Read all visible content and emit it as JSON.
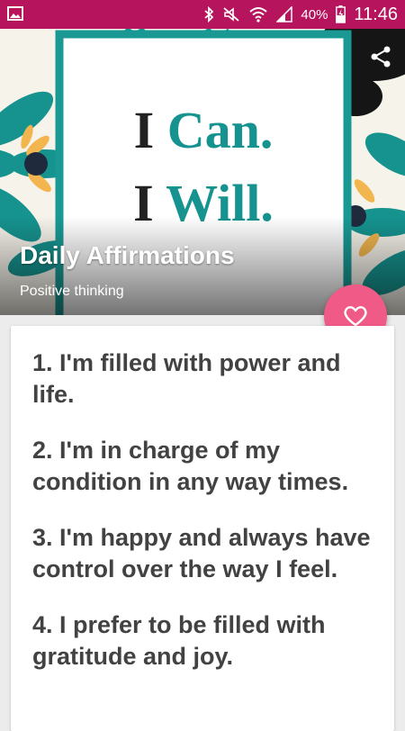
{
  "status_bar": {
    "battery": "40%",
    "time": "11:46",
    "icons": [
      "image-icon",
      "bluetooth-icon",
      "mute-icon",
      "wifi-icon",
      "signal-icon",
      "battery-icon"
    ],
    "color": "#b6155d"
  },
  "hero": {
    "art_line1": "I Can.",
    "art_line2": "I Will.",
    "title": "Daily Affirmations",
    "subtitle": "Positive thinking",
    "share_icon": "share-icon"
  },
  "fab": {
    "icon": "heart-icon",
    "color": "#f05a86"
  },
  "affirmations": [
    "1. I'm filled with power and life.",
    "2. I'm in charge of my condition in any way times.",
    "3. I'm happy and always have control over the way I feel.",
    "4. I prefer to be filled with gratitude and joy."
  ]
}
